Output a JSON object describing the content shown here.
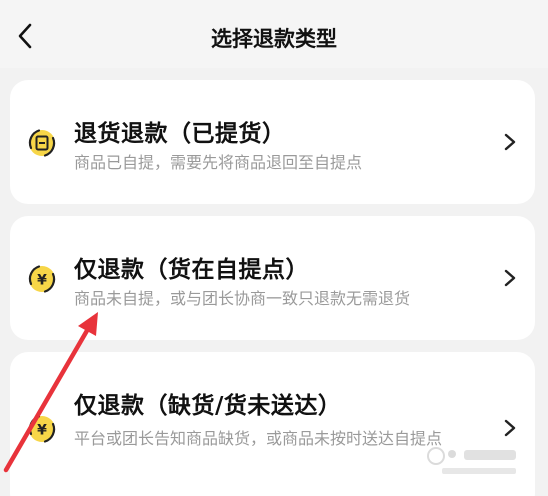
{
  "header": {
    "title": "选择退款类型",
    "back_icon": "chevron-left-icon"
  },
  "options": [
    {
      "title": "退货退款（已提货）",
      "description": "商品已自提，需要先将商品退回至自提点",
      "icon": "receipt-cycle-icon"
    },
    {
      "title": "仅退款（货在自提点）",
      "description": "商品未自提，或与团长协商一致只退款无需退货",
      "icon": "yen-cycle-icon"
    },
    {
      "title": "仅退款（缺货/货未送达）",
      "description": "平台或团长告知商品缺货，或商品未按时送达自提点",
      "icon": "yen-cycle-icon"
    }
  ],
  "colors": {
    "accent_yellow": "#f7d648",
    "arrow_red": "#e8333b",
    "muted_text": "#9a9a9a"
  }
}
